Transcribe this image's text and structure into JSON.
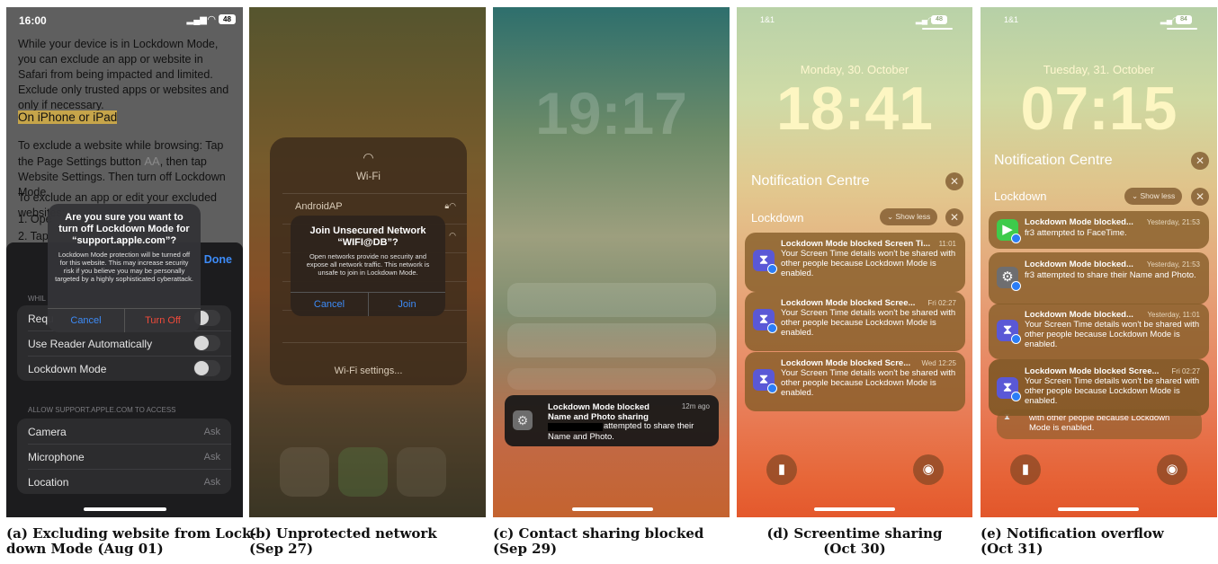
{
  "phone_a": {
    "time": "16:00",
    "battery": "48",
    "paragraph": "While your device is in Lockdown Mode, you can exclude an app or website in Safari from being impacted and limited. Exclude only trusted apps or websites and only if necessary.",
    "heading": "On iPhone or iPad",
    "instruction_pre": "To exclude a website while browsing: Tap the Page Settings button ",
    "instruction_glyph": "AA",
    "instruction_post": ", then tap Website Settings. Then turn off Lockdown Mode.",
    "instruction2": "To exclude an app or edit your excluded websites:",
    "list1": "1.  Ope",
    "list2": "2.  Tap",
    "done": "Done",
    "section_while": "WHIL",
    "row_req": "Requ",
    "row_reader": "Use Reader Automatically",
    "row_lockdown": "Lockdown Mode",
    "section_allow": "ALLOW SUPPORT.APPLE.COM TO ACCESS",
    "camera": "Camera",
    "microphone": "Microphone",
    "location": "Location",
    "ask": "Ask",
    "alert_title": "Are you sure you want to turn off Lockdown Mode for “support.apple.com”?",
    "alert_body": "Lockdown Mode protection will be turned off for this website. This may increase security risk if you believe you may be personally targeted by a highly sophisticated cyberattack.",
    "cancel": "Cancel",
    "turn_off": "Turn Off"
  },
  "phone_b": {
    "wifi_title": "Wi-Fi",
    "network1": "AndroidAP",
    "alert_title": "Join Unsecured Network “WIFI@DB”?",
    "alert_body": "Open networks provide no security and expose all network traffic. This network is unsafe to join in Lockdown Mode.",
    "cancel": "Cancel",
    "join": "Join",
    "settings": "Wi-Fi settings..."
  },
  "phone_c": {
    "clock": "19:17",
    "notif_title": "Lockdown Mode blocked Name and Photo sharing",
    "notif_time": "12m ago",
    "notif_body": "attempted to share their Name and Photo."
  },
  "phone_d": {
    "carrier": "1&1",
    "battery": "48",
    "date": "Monday, 30. October",
    "clock": "18:41",
    "nc_title": "Notification Centre",
    "group": "Lockdown",
    "show_less": "Show less",
    "notifications": [
      {
        "title": "Lockdown Mode blocked Screen Ti...",
        "time": "11:01",
        "body": "Your Screen Time details won't be shared with other people because Lockdown Mode is enabled."
      },
      {
        "title": "Lockdown Mode blocked Scree...",
        "time": "Fri 02:27",
        "body": "Your Screen Time details won't be shared with other people because Lockdown Mode is enabled."
      },
      {
        "title": "Lockdown Mode blocked Scre...",
        "time": "Wed 12:25",
        "body": "Your Screen Time details won't be shared with other people because Lockdown Mode is enabled."
      }
    ]
  },
  "phone_e": {
    "carrier": "1&1",
    "battery": "84",
    "date": "Tuesday, 31. October",
    "clock": "07:15",
    "nc_title": "Notification Centre",
    "group": "Lockdown",
    "show_less": "Show less",
    "notifications": [
      {
        "title": "Lockdown Mode blocked...",
        "time": "Yesterday, 21:53",
        "body": "fr3 attempted to FaceTime."
      },
      {
        "title": "Lockdown Mode blocked...",
        "time": "Yesterday, 21:53",
        "body": "fr3 attempted to share their Name and Photo."
      },
      {
        "title": "Lockdown Mode blocked...",
        "time": "Yesterday, 11:01",
        "body": "Your Screen Time details won't be shared with other people because Lockdown Mode is enabled."
      },
      {
        "title": "Lockdown Mode blocked Scree...",
        "time": "Fri 02:27",
        "body": "Your Screen Time details won't be shared with other people because Lockdown Mode is enabled."
      }
    ],
    "overflow_body": "with other people because Lockdown Mode is enabled."
  },
  "captions": {
    "a1": "(a) Excluding website from Lock-",
    "a2": "down Mode (Aug 01)",
    "b1": "(b) Unprotected network",
    "b2": "(Sep 27)",
    "c1": "(c) Contact sharing blocked",
    "c2": "(Sep 29)",
    "d1": "(d) Screentime sharing",
    "d2": "(Oct 30)",
    "e1": "(e) Notification overflow",
    "e2": "(Oct 31)"
  }
}
